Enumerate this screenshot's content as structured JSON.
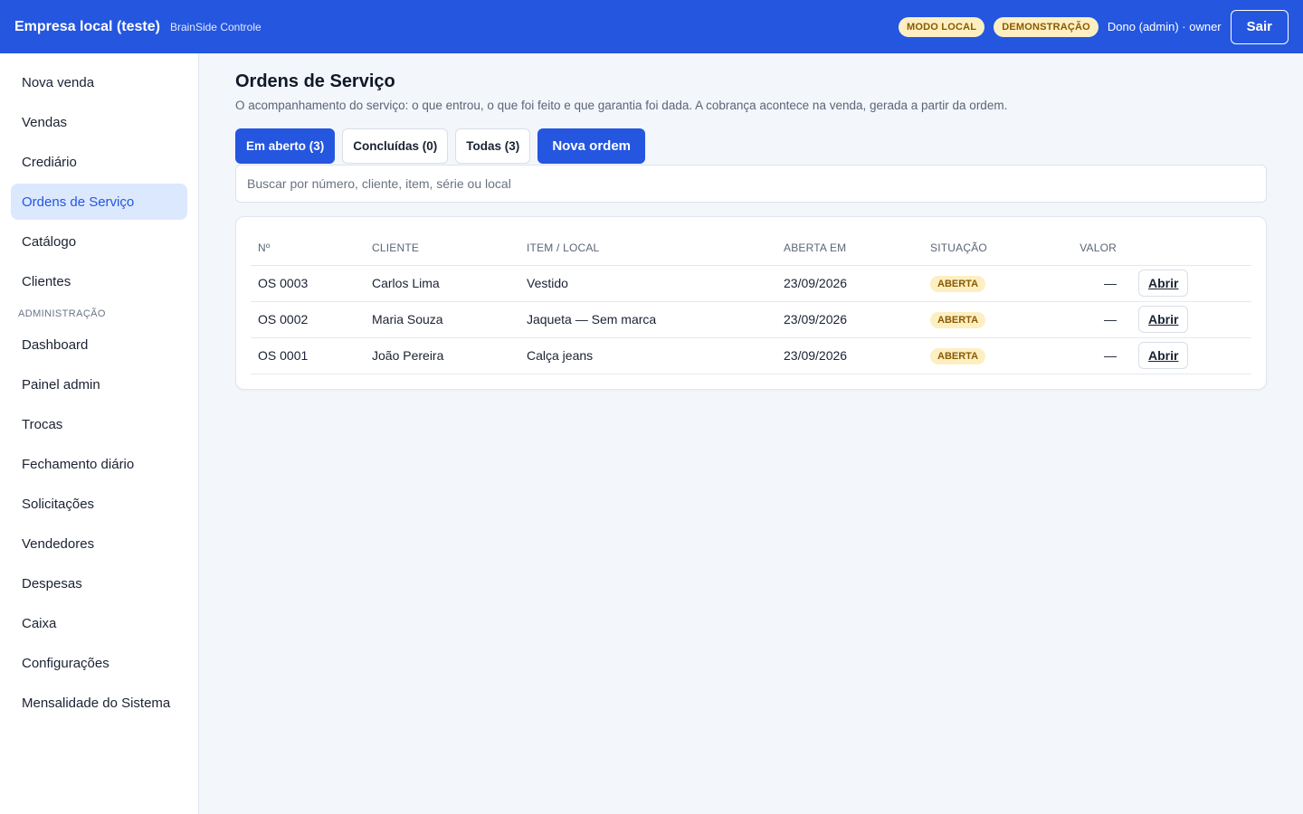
{
  "header": {
    "brand_title": "Empresa local (teste)",
    "brand_subtitle": "BrainSide Controle",
    "badges": [
      "MODO LOCAL",
      "DEMONSTRAÇÃO"
    ],
    "user": "Dono (admin) · owner",
    "logout_label": "Sair"
  },
  "sidebar": {
    "items": [
      {
        "label": "Nova venda"
      },
      {
        "label": "Vendas"
      },
      {
        "label": "Crediário"
      },
      {
        "label": "Ordens de Serviço",
        "active": true
      },
      {
        "label": "Catálogo"
      },
      {
        "label": "Clientes"
      }
    ],
    "admin_section_label": "ADMINISTRAÇÃO",
    "admin_items": [
      {
        "label": "Dashboard"
      },
      {
        "label": "Painel admin"
      },
      {
        "label": "Trocas"
      },
      {
        "label": "Fechamento diário"
      },
      {
        "label": "Solicitações"
      },
      {
        "label": "Vendedores"
      },
      {
        "label": "Despesas"
      },
      {
        "label": "Caixa"
      },
      {
        "label": "Configurações"
      },
      {
        "label": "Mensalidade do Sistema"
      }
    ]
  },
  "main": {
    "title": "Ordens de Serviço",
    "description": "O acompanhamento do serviço: o que entrou, o que foi feito e que garantia foi dada. A cobrança acontece na venda, gerada a partir da ordem.",
    "tabs": [
      {
        "label": "Em aberto (3)",
        "active": true
      },
      {
        "label": "Concluídas (0)"
      },
      {
        "label": "Todas (3)"
      }
    ],
    "new_order_label": "Nova ordem",
    "search_placeholder": "Buscar por número, cliente, item, série ou local",
    "table": {
      "columns": [
        "Nº",
        "CLIENTE",
        "ITEM / LOCAL",
        "ABERTA EM",
        "SITUAÇÃO",
        "VALOR"
      ],
      "open_label": "Abrir",
      "rows": [
        {
          "number": "OS 0003",
          "client": "Carlos Lima",
          "item": "Vestido",
          "opened": "23/09/2026",
          "status": "ABERTA",
          "value": "—"
        },
        {
          "number": "OS 0002",
          "client": "Maria Souza",
          "item": "Jaqueta — Sem marca",
          "opened": "23/09/2026",
          "status": "ABERTA",
          "value": "—"
        },
        {
          "number": "OS 0001",
          "client": "João Pereira",
          "item": "Calça jeans",
          "opened": "23/09/2026",
          "status": "ABERTA",
          "value": "—"
        }
      ]
    }
  },
  "colors": {
    "primary": "#2456e0",
    "badge_bg": "#fdefc2",
    "badge_text": "#8a5a00",
    "active_nav_bg": "#dce8fd"
  }
}
